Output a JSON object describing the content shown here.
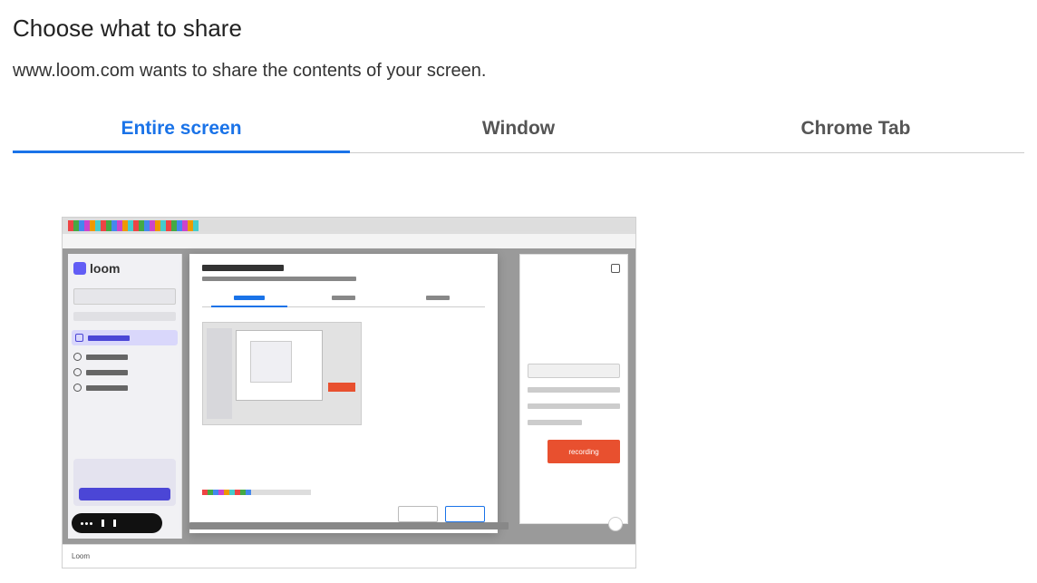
{
  "dialog": {
    "title": "Choose what to share",
    "subtitle": "www.loom.com wants to share the contents of your screen."
  },
  "tabs": {
    "entire_screen": "Entire screen",
    "window": "Window",
    "chrome_tab": "Chrome Tab"
  },
  "thumbnail": {
    "sidebar_brand": "loom",
    "record_button": "recording",
    "footer_caption": "Loom"
  }
}
